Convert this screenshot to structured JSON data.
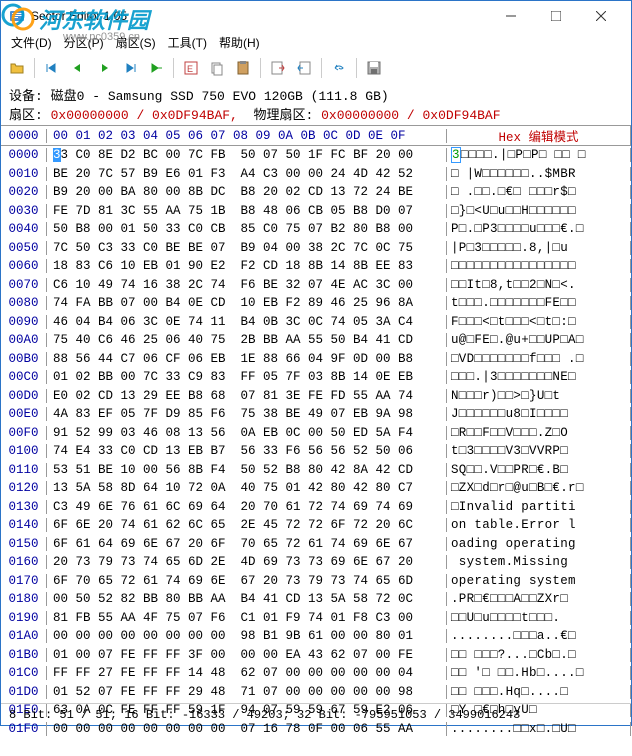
{
  "title": "Sector Editor 1.05",
  "menu": {
    "file": "文件(D)",
    "partition": "分区(P)",
    "sector": "扇区(S)",
    "tools": "工具(T)",
    "help": "帮助(H)"
  },
  "info": {
    "device_label": "设备:",
    "device": "磁盘0 - Samsung SSD 750 EVO 120GB (111.8 GB)",
    "sector_label": "扇区:",
    "sector": "0x00000000 / 0x0DF94BAF,",
    "phys_label": "物理扇区:",
    "phys": "0x00000000 / 0x0DF94BAF"
  },
  "header": {
    "offset": "0000",
    "bytes": "00 01 02 03 04 05 06 07  08 09 0A 0B 0C 0D 0E 0F",
    "ascii": "Hex 编辑模式"
  },
  "rows": [
    {
      "off": "0000",
      "b": "33 C0 8E D2 BC 00 7C FB  50 07 50 1F FC BF 20 00",
      "a": "3□□□□.|□P□P□ □□ □"
    },
    {
      "off": "0010",
      "b": "BE 20 7C 57 B9 E6 01 F3  A4 C3 00 00 24 4D 42 52",
      "a": "□ |W□□□□□□..$MBR"
    },
    {
      "off": "0020",
      "b": "B9 20 00 BA 80 00 8B DC  B8 20 02 CD 13 72 24 BE",
      "a": "□ .□□.□€□ □□□r$□"
    },
    {
      "off": "0030",
      "b": "FE 7D 81 3C 55 AA 75 1B  B8 48 06 CB 05 B8 D0 07",
      "a": "□}□<U□u□□H□□□□□□"
    },
    {
      "off": "0040",
      "b": "50 B8 00 01 50 33 C0 CB  85 C0 75 07 B2 80 B8 00",
      "a": "P□.□P3□□□□u□□□€.□"
    },
    {
      "off": "0050",
      "b": "7C 50 C3 33 C0 BE BE 07  B9 04 00 38 2C 7C 0C 75",
      "a": "|P□3□□□□□.8,|□u"
    },
    {
      "off": "0060",
      "b": "18 83 C6 10 EB 01 90 E2  F2 CD 18 8B 14 8B EE 83",
      "a": "□□□□□□□□□□□□□□□□"
    },
    {
      "off": "0070",
      "b": "C6 10 49 74 16 38 2C 74  F6 BE 32 07 4E AC 3C 00",
      "a": "□□It□8,t□□2□N□<."
    },
    {
      "off": "0080",
      "b": "74 FA BB 07 00 B4 0E CD  10 EB F2 89 46 25 96 8A",
      "a": "t□□□.□□□□□□□FE□□"
    },
    {
      "off": "0090",
      "b": "46 04 B4 06 3C 0E 74 11  B4 0B 3C 0C 74 05 3A C4",
      "a": "F□□□<□t□□□<□t□:□"
    },
    {
      "off": "00A0",
      "b": "75 40 C6 46 25 06 40 75  2B BB AA 55 50 B4 41 CD",
      "a": "u@□FE□.@u+□□UP□A□"
    },
    {
      "off": "00B0",
      "b": "88 56 44 C7 06 CF 06 EB  1E 88 66 04 9F 0D 00 B8",
      "a": "□VD□□□□□□□f□□□ .□"
    },
    {
      "off": "00C0",
      "b": "01 02 BB 00 7C 33 C9 83  FF 05 7F 03 8B 14 0E EB",
      "a": "□□□.|3□□□□□□□NE□"
    },
    {
      "off": "00D0",
      "b": "E0 02 CD 13 29 EE B8 68  07 81 3E FE FD 55 AA 74",
      "a": "N□□□r)□□>□}U□t"
    },
    {
      "off": "00E0",
      "b": "4A 83 EF 05 7F D9 85 F6  75 38 BE 49 07 EB 9A 98",
      "a": "J□□□□□□u8□I□□□□"
    },
    {
      "off": "00F0",
      "b": "91 52 99 03 46 08 13 56  0A EB 0C 00 50 ED 5A F4",
      "a": "□R□□F□□V□□□.Z□O"
    },
    {
      "off": "0100",
      "b": "74 E4 33 C0 CD 13 EB B7  56 33 F6 56 56 52 50 06",
      "a": "t□3□□□□V3□VVRP□"
    },
    {
      "off": "0110",
      "b": "53 51 BE 10 00 56 8B F4  50 52 B8 80 42 8A 42 CD",
      "a": "SQ□□.V□□PR□€.B□"
    },
    {
      "off": "0120",
      "b": "13 5A 58 8D 64 10 72 0A  40 75 01 42 80 42 80 C7",
      "a": "□ZX□d□r□@u□B□€.r□"
    },
    {
      "off": "0130",
      "b": "C3 49 6E 76 61 6C 69 64  20 70 61 72 74 69 74 69",
      "a": "□Invalid partiti"
    },
    {
      "off": "0140",
      "b": "6F 6E 20 74 61 62 6C 65  2E 45 72 72 6F 72 20 6C",
      "a": "on table.Error l"
    },
    {
      "off": "0150",
      "b": "6F 61 64 69 6E 67 20 6F  70 65 72 61 74 69 6E 67",
      "a": "oading operating"
    },
    {
      "off": "0160",
      "b": "20 73 79 73 74 65 6D 2E  4D 69 73 73 69 6E 67 20",
      "a": " system.Missing "
    },
    {
      "off": "0170",
      "b": "6F 70 65 72 61 74 69 6E  67 20 73 79 73 74 65 6D",
      "a": "operating system"
    },
    {
      "off": "0180",
      "b": "00 50 52 82 BB 80 BB AA  B4 41 CD 13 5A 58 72 0C",
      "a": ".PR□€□□□A□□ZXr□"
    },
    {
      "off": "0190",
      "b": "81 FB 55 AA 4F 75 07 F6  C1 01 F9 74 01 F8 C3 00",
      "a": "□□U□u□□□□t□□□."
    },
    {
      "off": "01A0",
      "b": "00 00 00 00 00 00 00 00  98 B1 9B 61 00 00 80 01",
      "a": "........□□□a..€□"
    },
    {
      "off": "01B0",
      "b": "01 00 07 FE FF FF 3F 00  00 00 EA 43 62 07 00 FE",
      "a": "□□ □□□?...□Cb□.□"
    },
    {
      "off": "01C0",
      "b": "FF FF 27 FE FF FF 14 48  62 07 00 00 00 00 00 04",
      "a": "□□ '□ □□.Hb□....□"
    },
    {
      "off": "01D0",
      "b": "01 52 07 FE FF FF 29 48  71 07 00 00 00 00 00 98",
      "a": "□□ □□□.Hq□....□"
    },
    {
      "off": "01E0",
      "b": "63 0A 0C FE FF FF 59 1F  94 07 59 59 67 59 E2 06",
      "a": "□Y □€□h□yU□"
    },
    {
      "off": "01F0",
      "b": "00 00 00 00 00 00 00 00  07 16 78 0F 00 06 55 AA",
      "a": "........□□x□.□U□"
    }
  ],
  "status": "8 Bit: 51 / 51;   16 Bit: -16333 / 49203;   32 Bit: -795951053 / 3499016243",
  "watermark": {
    "main": "河东软件园",
    "sub": "www.pc0359.cn"
  }
}
